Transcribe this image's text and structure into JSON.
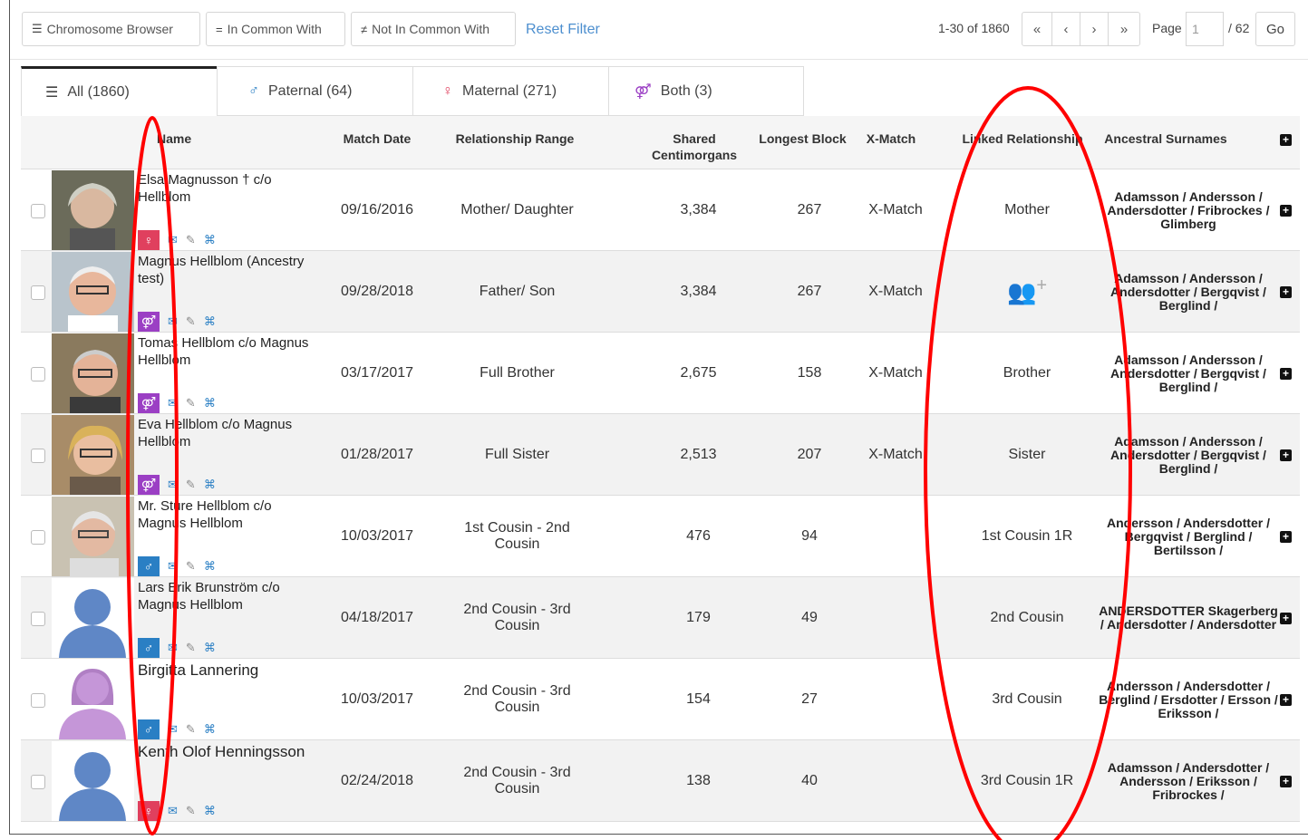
{
  "toolbar": {
    "chromosome_browser": "Chromosome Browser",
    "in_common_with": "In Common With",
    "not_in_common_with": "Not In Common With",
    "reset_filter": "Reset Filter",
    "range": "1-30 of 1860",
    "first": "«",
    "prev": "‹",
    "next": "›",
    "last": "»",
    "page_label": "Page",
    "page_value": "1",
    "total_pages": "/ 62",
    "go": "Go"
  },
  "tabs": [
    {
      "label": "All (1860)"
    },
    {
      "label": "Paternal (64)"
    },
    {
      "label": "Maternal (271)"
    },
    {
      "label": "Both (3)"
    }
  ],
  "columns": {
    "name": "Name",
    "match_date": "Match Date",
    "relationship_range": "Relationship Range",
    "shared_cm": "Shared Centimorgans",
    "longest_block": "Longest Block",
    "x_match": "X-Match",
    "linked_relationship": "Linked Relationship",
    "ancestral_surnames": "Ancestral Surnames"
  },
  "rows": [
    {
      "name": "Elsa Magnusson † c/o Hellblom",
      "date": "09/16/2016",
      "range": "Mother/ Daughter",
      "cm": "3,384",
      "block": "267",
      "x": "X-Match",
      "linked": "Mother",
      "surnames": "Adamsson / Andersson / Andersdotter / Fribrockes / Glimberg",
      "sex": "female",
      "sexcolor": "#e0405e"
    },
    {
      "name": "Magnus Hellblom (Ancestry test)",
      "date": "09/28/2018",
      "range": "Father/ Son",
      "cm": "3,384",
      "block": "267",
      "x": "X-Match",
      "linked": "",
      "surnames": "Adamsson / Andersson / Andersdotter / Bergqvist / Berglind /",
      "sex": "both",
      "sexcolor": "#9b3fc4"
    },
    {
      "name": "Tomas Hellblom c/o Magnus Hellblom",
      "date": "03/17/2017",
      "range": "Full Brother",
      "cm": "2,675",
      "block": "158",
      "x": "X-Match",
      "linked": "Brother",
      "surnames": "Adamsson / Andersson / Andersdotter / Bergqvist / Berglind /",
      "sex": "both",
      "sexcolor": "#9b3fc4"
    },
    {
      "name": "Eva Hellblom c/o Magnus Hellblom",
      "date": "01/28/2017",
      "range": "Full Sister",
      "cm": "2,513",
      "block": "207",
      "x": "X-Match",
      "linked": "Sister",
      "surnames": "Adamsson / Andersson / Andersdotter / Bergqvist / Berglind /",
      "sex": "both",
      "sexcolor": "#9b3fc4"
    },
    {
      "name": "Mr. Sture Hellblom c/o Magnus Hellblom",
      "date": "10/03/2017",
      "range": "1st Cousin - 2nd Cousin",
      "cm": "476",
      "block": "94",
      "x": "",
      "linked": "1st Cousin 1R",
      "surnames": "Andersson / Andersdotter / Bergqvist / Berglind / Bertilsson /",
      "sex": "male",
      "sexcolor": "#2a7fc4"
    },
    {
      "name": "Lars Erik Brunström c/o Magnus Hellblom",
      "date": "04/18/2017",
      "range": "2nd Cousin - 3rd Cousin",
      "cm": "179",
      "block": "49",
      "x": "",
      "linked": "2nd Cousin",
      "surnames": "ANDERSDOTTER Skagerberg / Andersdotter / Andersdotter",
      "sex": "male",
      "sexcolor": "#2a7fc4"
    },
    {
      "name": "Birgitta Lannering",
      "date": "10/03/2017",
      "range": "2nd Cousin - 3rd Cousin",
      "cm": "154",
      "block": "27",
      "x": "",
      "linked": "3rd Cousin",
      "surnames": "Andersson / Andersdotter / Berglind / Ersdotter / Ersson / Eriksson /",
      "sex": "male",
      "sexcolor": "#2a7fc4"
    },
    {
      "name": "Kenth Olof Henningsson",
      "date": "02/24/2018",
      "range": "2nd Cousin - 3rd Cousin",
      "cm": "138",
      "block": "40",
      "x": "",
      "linked": "3rd Cousin 1R",
      "surnames": "Adamsson / Andersdotter / Andersson / Eriksson / Fribrockes /",
      "sex": "female",
      "sexcolor": "#e0405e"
    }
  ],
  "colors": {
    "link": "#4d8fcf",
    "annotation": "#ff0000",
    "female": "#e0405e",
    "male": "#2a7fc4",
    "both": "#9b3fc4"
  },
  "icons": [
    "list-icon",
    "equals-icon",
    "not-equal-icon",
    "female-icon",
    "male-icon",
    "couple-icon",
    "envelope-icon",
    "edit-icon",
    "tree-icon",
    "add-person-icon",
    "plus-box-icon"
  ]
}
